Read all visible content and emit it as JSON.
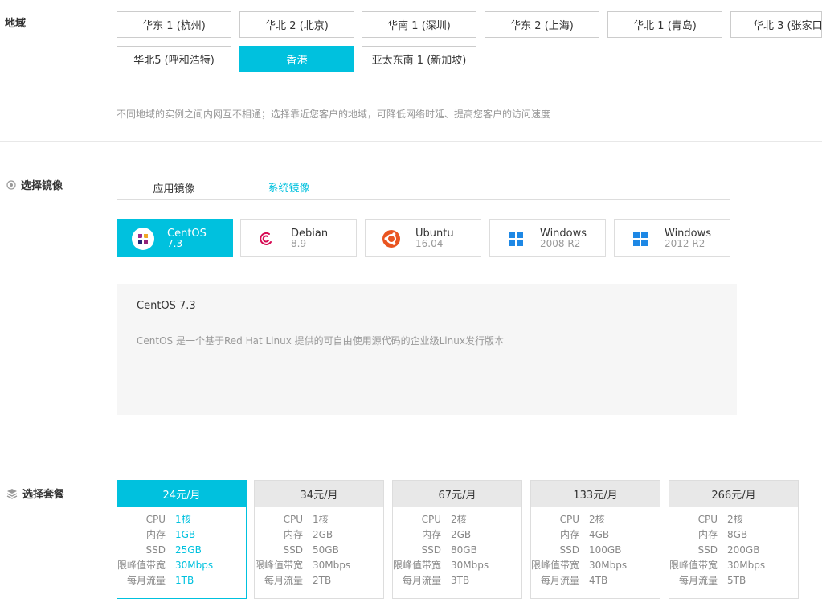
{
  "region": {
    "label": "地域",
    "options": [
      "华东 1 (杭州)",
      "华北 2 (北京)",
      "华南 1 (深圳)",
      "华东 2 (上海)",
      "华北 1 (青岛)",
      "华北 3 (张家口)",
      "华北5 (呼和浩特)",
      "香港",
      "亚太东南 1 (新加坡)"
    ],
    "selected": "香港",
    "hint": "不同地域的实例之间内网互不相通；选择靠近您客户的地域，可降低网络时延、提高您客户的访问速度"
  },
  "image": {
    "label": "选择镜像",
    "tabs": [
      "应用镜像",
      "系统镜像"
    ],
    "active_tab": "系统镜像",
    "os_list": [
      {
        "name": "CentOS",
        "version": "7.3",
        "icon": "centos-icon"
      },
      {
        "name": "Debian",
        "version": "8.9",
        "icon": "debian-icon"
      },
      {
        "name": "Ubuntu",
        "version": "16.04",
        "icon": "ubuntu-icon"
      },
      {
        "name": "Windows",
        "version": "2008 R2",
        "icon": "windows-icon"
      },
      {
        "name": "Windows",
        "version": "2012 R2",
        "icon": "windows-icon"
      }
    ],
    "selected_os": "CentOS 7.3",
    "description_title": "CentOS 7.3",
    "description": "CentOS 是一个基于Red Hat Linux 提供的可自由使用源代码的企业级Linux发行版本"
  },
  "plans": {
    "label": "选择套餐",
    "row_labels": [
      "CPU",
      "内存",
      "SSD",
      "限峰值带宽",
      "每月流量"
    ],
    "items": [
      {
        "price": "24元/月",
        "values": [
          "1核",
          "1GB",
          "25GB",
          "30Mbps",
          "1TB"
        ]
      },
      {
        "price": "34元/月",
        "values": [
          "1核",
          "2GB",
          "50GB",
          "30Mbps",
          "2TB"
        ]
      },
      {
        "price": "67元/月",
        "values": [
          "2核",
          "2GB",
          "80GB",
          "30Mbps",
          "3TB"
        ]
      },
      {
        "price": "133元/月",
        "values": [
          "2核",
          "4GB",
          "100GB",
          "30Mbps",
          "4TB"
        ]
      },
      {
        "price": "266元/月",
        "values": [
          "2核",
          "8GB",
          "200GB",
          "30Mbps",
          "5TB"
        ]
      }
    ],
    "selected": "24元/月"
  },
  "colors": {
    "accent": "#00c1de",
    "windows_blue": "#1e88e5",
    "ubuntu_orange": "#e95420",
    "debian_red": "#d70a53"
  }
}
